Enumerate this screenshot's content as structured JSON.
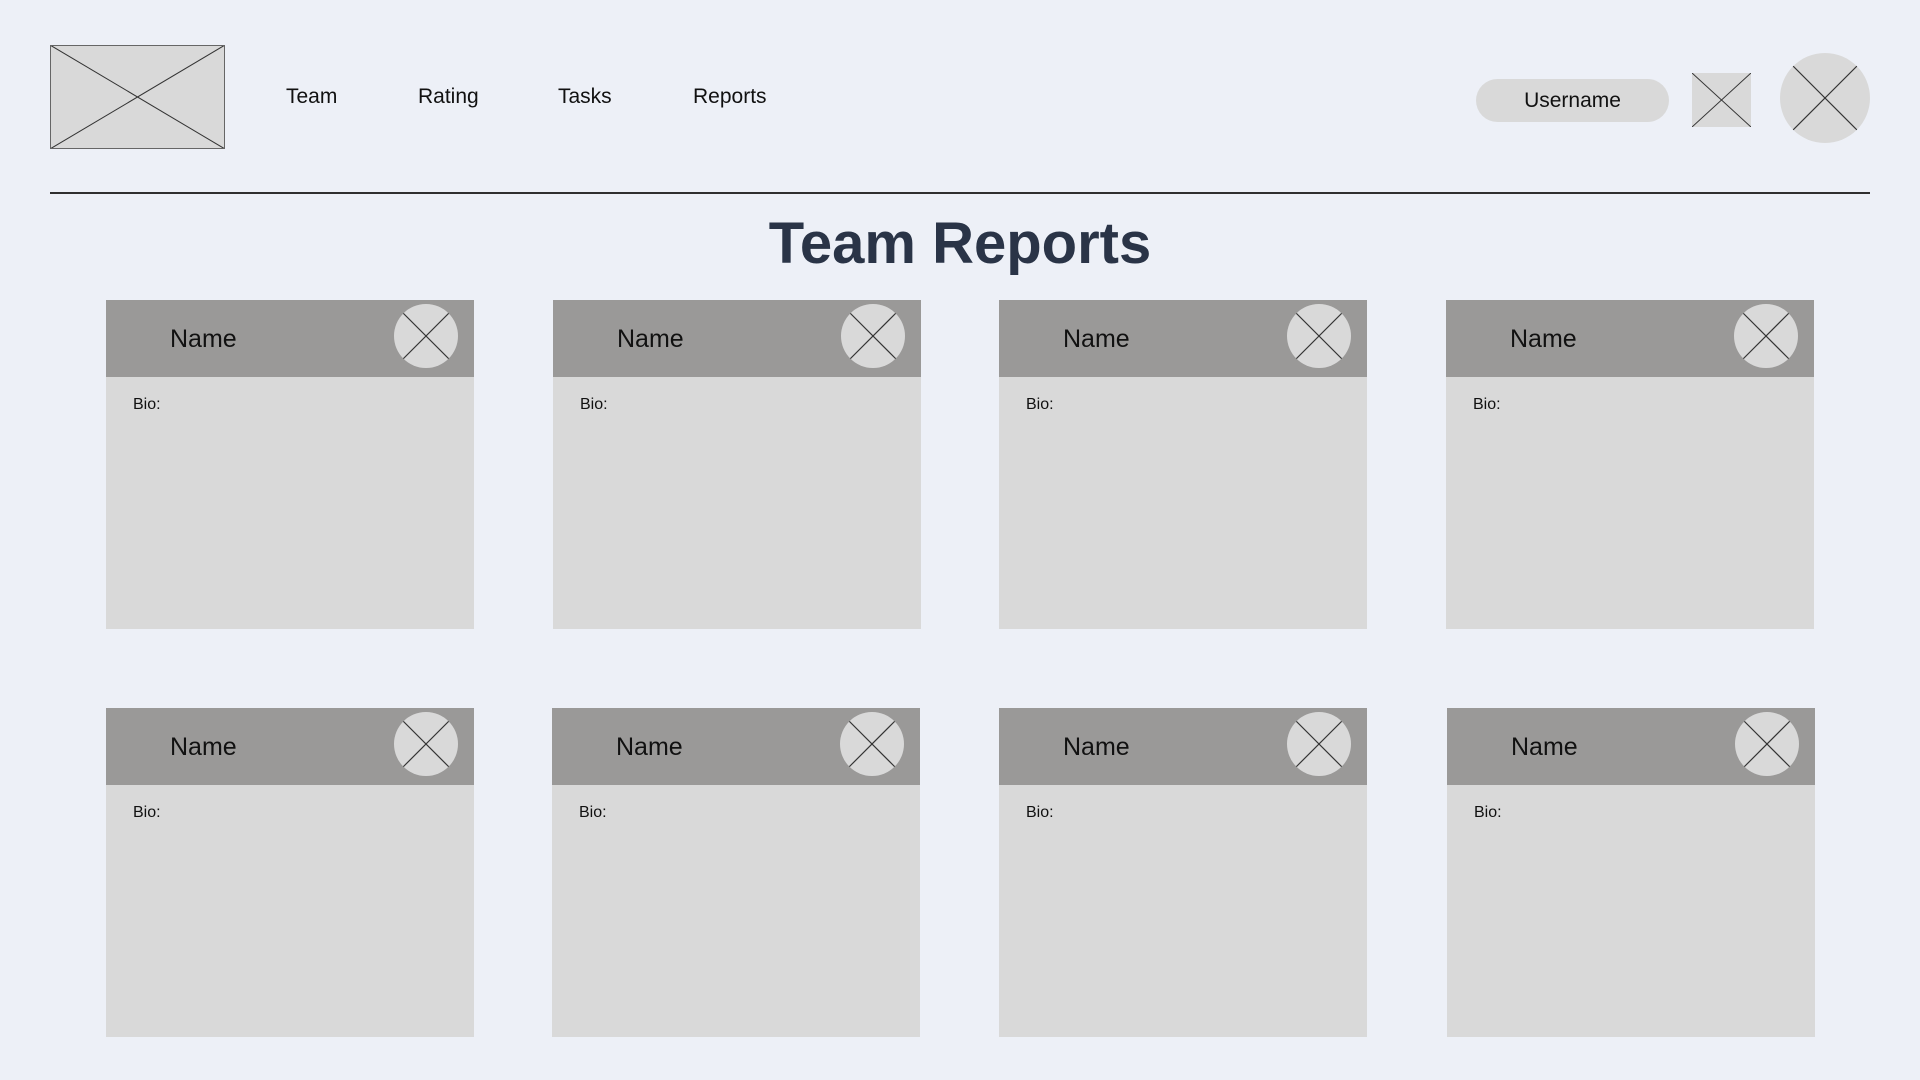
{
  "header": {
    "nav": [
      "Team",
      "Rating",
      "Tasks",
      "Reports"
    ],
    "username": "Username"
  },
  "main": {
    "title": "Team Reports",
    "cards": [
      {
        "name": "Name",
        "bio_label": "Bio:"
      },
      {
        "name": "Name",
        "bio_label": "Bio:"
      },
      {
        "name": "Name",
        "bio_label": "Bio:"
      },
      {
        "name": "Name",
        "bio_label": "Bio:"
      },
      {
        "name": "Name",
        "bio_label": "Bio:"
      },
      {
        "name": "Name",
        "bio_label": "Bio:"
      },
      {
        "name": "Name",
        "bio_label": "Bio:"
      },
      {
        "name": "Name",
        "bio_label": "Bio:"
      }
    ]
  },
  "colors": {
    "background": "#edf0f7",
    "placeholder": "#d9d9d9",
    "card_header": "#9a9998",
    "title": "#2a3447"
  }
}
